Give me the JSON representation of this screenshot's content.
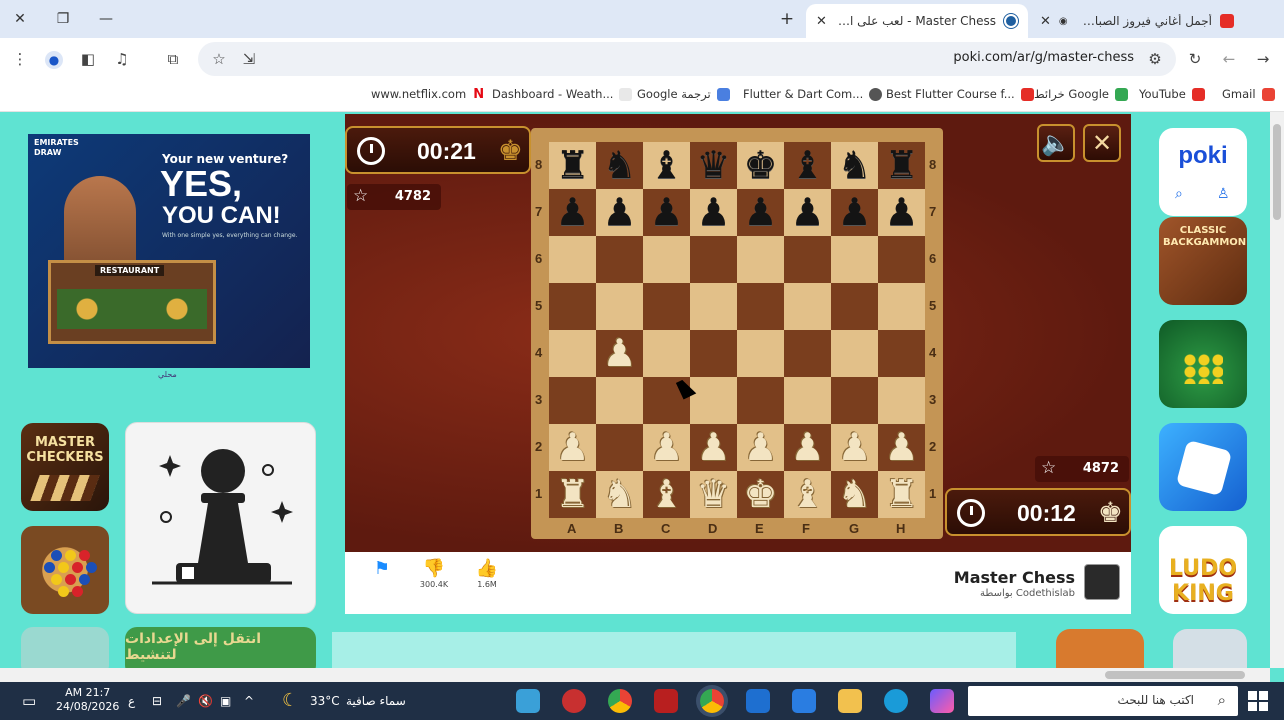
{
  "browser": {
    "tabs": [
      {
        "title": "أجمل أغاني فيروز الصباحية #",
        "icon": "youtube-icon"
      },
      {
        "title": "Master Chess - لعب على الإنترنت مجاناً",
        "icon": "poki-icon",
        "active": true
      }
    ],
    "url": "poki.com/ar/g/master-chess",
    "bookmarks": [
      {
        "label": "Gmail",
        "icon": "gmail-icon"
      },
      {
        "label": "YouTube",
        "icon": "youtube-icon"
      },
      {
        "label": "خرائط Google",
        "icon": "maps-icon"
      },
      {
        "label": "Best Flutter Course f...",
        "icon": "youtube-icon"
      },
      {
        "label": "Flutter & Dart Com...",
        "icon": "globe-icon"
      },
      {
        "label": "Google ترجمة",
        "icon": "translate-icon"
      },
      {
        "label": "Dashboard - Weath...",
        "icon": "page-icon"
      },
      {
        "label": "www.netflix.com",
        "icon": "netflix-icon"
      }
    ]
  },
  "ad": {
    "brand": "EMIRATES DRAW",
    "question": "Your new venture?",
    "headline1": "YES,",
    "headline2": "YOU CAN!",
    "fine": "With one simple yes, everything can change.",
    "shop_sign": "RESTAURANT",
    "caption": "محلي"
  },
  "left_tiles": {
    "checkers": "MASTER CHECKERS",
    "dots_colors": [
      "#1b4fb8",
      "#f2c81a",
      "#d8232a"
    ],
    "bottom_label": "انتقل إلى الإعدادات لتنشيط"
  },
  "game": {
    "top_timer": "00:21",
    "top_score": "4782",
    "bottom_timer": "00:12",
    "bottom_score": "4872",
    "ranks": [
      "8",
      "7",
      "6",
      "5",
      "4",
      "3",
      "2",
      "1"
    ],
    "files": [
      "A",
      "B",
      "C",
      "D",
      "E",
      "F",
      "G",
      "H"
    ],
    "colors": {
      "light": "#e2c089",
      "dark": "#7a3e1e"
    },
    "board": [
      [
        "bR",
        "bN",
        "bB",
        "bQ",
        "bK",
        "bB",
        "bN",
        "bR"
      ],
      [
        "bP",
        "bP",
        "bP",
        "bP",
        "bP",
        "bP",
        "bP",
        "bP"
      ],
      [
        "",
        "",
        "",
        "",
        "",
        "",
        "",
        ""
      ],
      [
        "",
        "",
        "",
        "",
        "",
        "",
        "",
        ""
      ],
      [
        "",
        "wP",
        "",
        "",
        "",
        "",
        "",
        ""
      ],
      [
        "",
        "",
        "",
        "",
        "",
        "",
        "",
        ""
      ],
      [
        "wP",
        "",
        "wP",
        "wP",
        "wP",
        "wP",
        "wP",
        "wP"
      ],
      [
        "wR",
        "wN",
        "wB",
        "wQ",
        "wK",
        "wB",
        "wN",
        "wR"
      ]
    ],
    "footer": {
      "likes": "300.4K",
      "plays": "1.6M",
      "title": "Master Chess",
      "developer": "بواسطة Codethislab"
    }
  },
  "right_tiles": {
    "logo": "poki",
    "backgammon": "CLASSIC BACKGAMMON",
    "ludo": "LUDO KING"
  },
  "taskbar": {
    "search_placeholder": "اكتب هنا للبحث",
    "weather": "سماء صافية",
    "temperature": "33°C",
    "time": "AM 21:7",
    "date": "24/08/2026",
    "lang": "ع"
  }
}
